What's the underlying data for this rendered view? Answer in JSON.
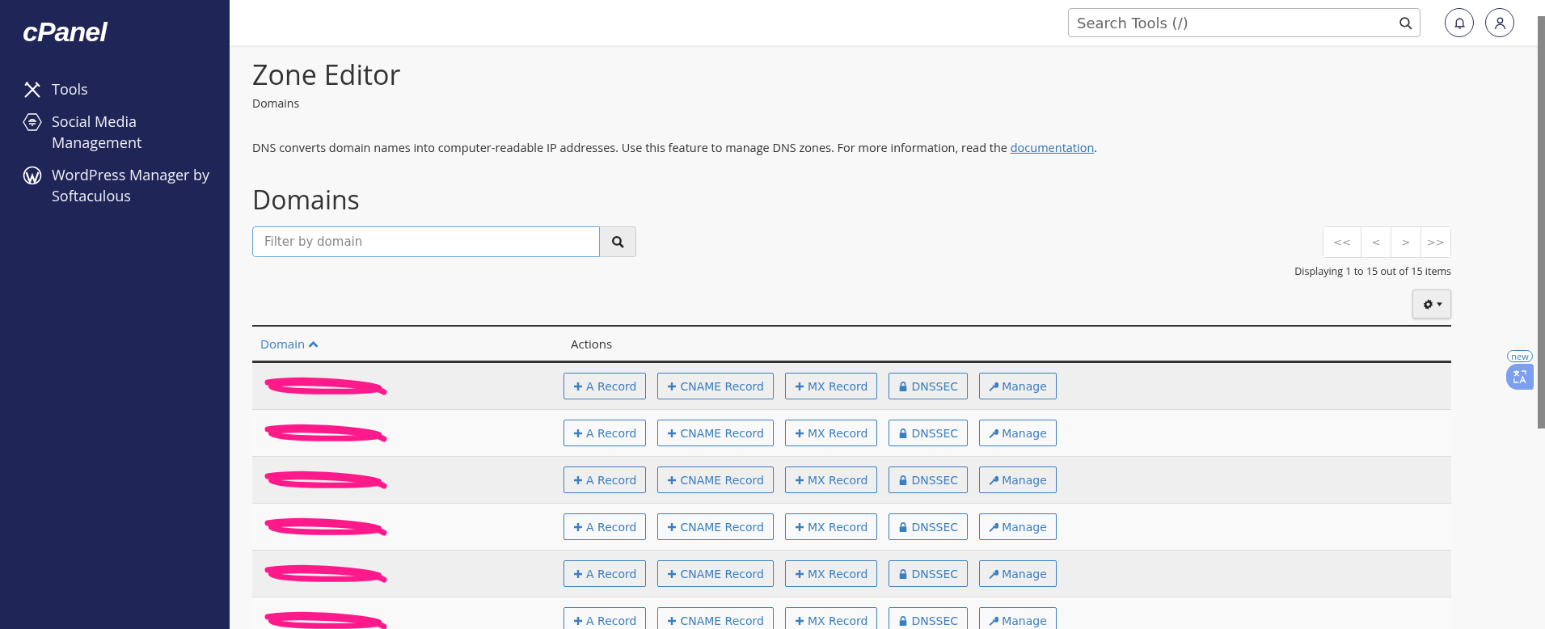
{
  "sidebar": {
    "logo": "cPanel",
    "items": [
      {
        "kind": "tools",
        "label": "Tools"
      },
      {
        "kind": "social",
        "label": "Social Media Management"
      },
      {
        "kind": "wordpress",
        "label": "WordPress Manager by Softaculous"
      }
    ]
  },
  "header": {
    "search": {
      "placeholder": "Search Tools (/)"
    }
  },
  "page": {
    "title": "Zone Editor",
    "breadcrumb": "Domains",
    "description": "DNS converts domain names into computer-readable IP addresses. Use this feature to manage DNS zones. For more information, read the ",
    "link": "documentation",
    "description_end": "."
  },
  "section": {
    "title": "Domains",
    "filter": {
      "placeholder": "Filter by domain"
    },
    "pagination": [
      "<<",
      "<",
      ">",
      ">>"
    ],
    "summary": "Displaying 1 to 15 out of 15 items"
  },
  "table": {
    "columns": [
      {
        "label": "Domain",
        "sorted": true
      },
      {
        "label": "Actions",
        "sorted": false
      }
    ],
    "rows": [
      {
        "redacted": true,
        "actions": [
          {
            "kind": "plus",
            "label": "A Record"
          },
          {
            "kind": "plus",
            "label": "CNAME Record"
          },
          {
            "kind": "plus",
            "label": "MX Record"
          },
          {
            "kind": "lock",
            "label": "DNSSEC"
          },
          {
            "kind": "wrench",
            "label": "Manage"
          }
        ]
      },
      {
        "redacted": true,
        "actions": [
          {
            "kind": "plus",
            "label": "A Record"
          },
          {
            "kind": "plus",
            "label": "CNAME Record"
          },
          {
            "kind": "plus",
            "label": "MX Record"
          },
          {
            "kind": "lock",
            "label": "DNSSEC"
          },
          {
            "kind": "wrench",
            "label": "Manage"
          }
        ]
      },
      {
        "redacted": true,
        "actions": [
          {
            "kind": "plus",
            "label": "A Record"
          },
          {
            "kind": "plus",
            "label": "CNAME Record"
          },
          {
            "kind": "plus",
            "label": "MX Record"
          },
          {
            "kind": "lock",
            "label": "DNSSEC"
          },
          {
            "kind": "wrench",
            "label": "Manage"
          }
        ]
      },
      {
        "redacted": true,
        "actions": [
          {
            "kind": "plus",
            "label": "A Record"
          },
          {
            "kind": "plus",
            "label": "CNAME Record"
          },
          {
            "kind": "plus",
            "label": "MX Record"
          },
          {
            "kind": "lock",
            "label": "DNSSEC"
          },
          {
            "kind": "wrench",
            "label": "Manage"
          }
        ]
      },
      {
        "redacted": true,
        "actions": [
          {
            "kind": "plus",
            "label": "A Record"
          },
          {
            "kind": "plus",
            "label": "CNAME Record"
          },
          {
            "kind": "plus",
            "label": "MX Record"
          },
          {
            "kind": "lock",
            "label": "DNSSEC"
          },
          {
            "kind": "wrench",
            "label": "Manage"
          }
        ]
      },
      {
        "redacted": true,
        "actions": [
          {
            "kind": "plus",
            "label": "A Record"
          },
          {
            "kind": "plus",
            "label": "CNAME Record"
          },
          {
            "kind": "plus",
            "label": "MX Record"
          },
          {
            "kind": "lock",
            "label": "DNSSEC"
          },
          {
            "kind": "wrench",
            "label": "Manage"
          }
        ]
      }
    ]
  },
  "widget": {
    "badge": "new"
  }
}
